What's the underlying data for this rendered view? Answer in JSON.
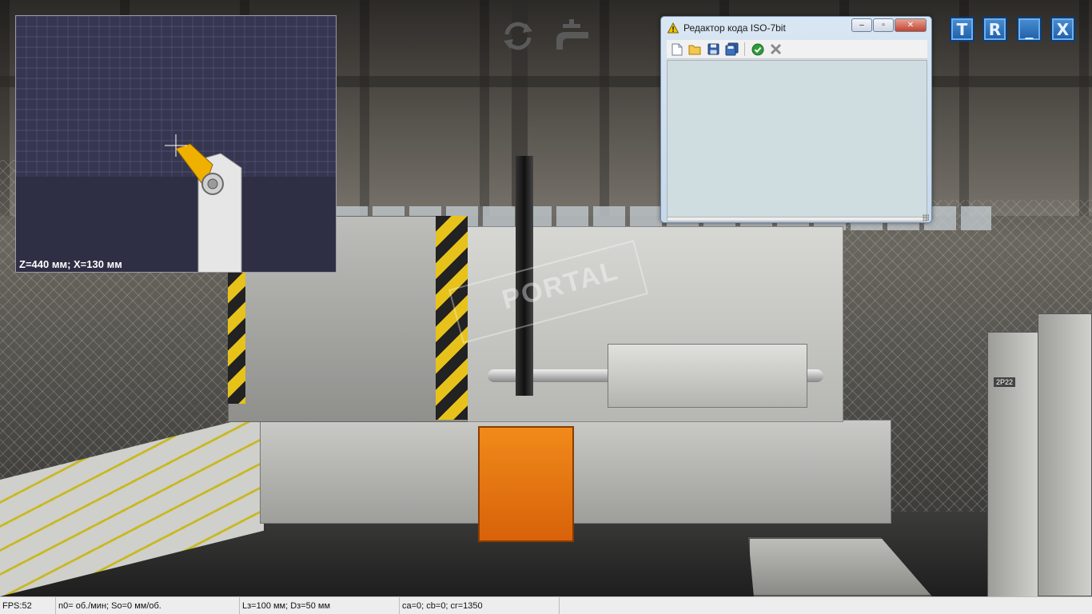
{
  "preview": {
    "readout": "Z=440 мм; X=130 мм",
    "colors": {
      "background": "#363650",
      "grid": "#55557a",
      "insert": "#f0b000",
      "holder": "#e6e6e6"
    }
  },
  "toolbar_top": {
    "icons": [
      "rotate-view-icon",
      "coolant-tap-icon"
    ]
  },
  "window_buttons": {
    "top_button": "T",
    "reset_button": "R",
    "minimize_button": "_",
    "close_button": "X"
  },
  "editor": {
    "title": "Редактор кода ISO-7bit",
    "code": "",
    "toolbar_icons": [
      "new-file-icon",
      "open-folder-icon",
      "save-icon",
      "save-all-icon",
      "check-run-icon",
      "cancel-x-icon"
    ],
    "window_controls": {
      "minimize": "–",
      "restore": "▫",
      "close": "✕"
    }
  },
  "scene": {
    "watermark": "PORTAL",
    "cabinet_label": "2Р22"
  },
  "statusbar": {
    "fps": "FPS:52",
    "spindle": "n0= об./мин;  So=0 мм/об.",
    "dims": "Lз=100 мм;  Dз=50 мм",
    "angles": "ca=0;  cb=0;  cr=1350"
  }
}
